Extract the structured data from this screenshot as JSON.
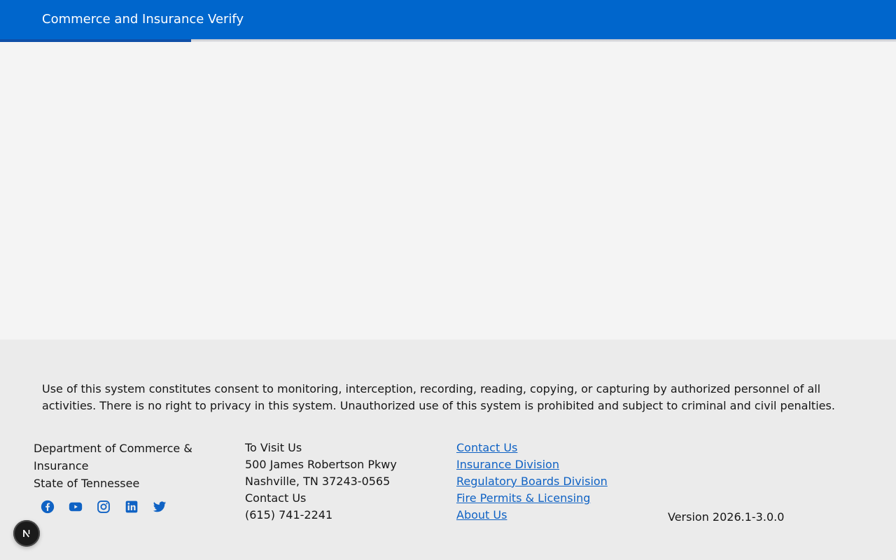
{
  "header": {
    "title": "Commerce and Insurance Verify",
    "background": "#0066cc",
    "progress_fraction": 0.213
  },
  "footer": {
    "disclaimer": "Use of this system constitutes consent to monitoring, interception, recording, reading, copying, or capturing by authorized personnel of all activities. There is no right to privacy in this system. Unauthorized use of this system is prohibited and subject to criminal and civil penalties.",
    "department": {
      "name": "Department of Commerce & Insurance",
      "state": "State of Tennessee"
    },
    "social_icons": [
      "facebook-icon",
      "youtube-icon",
      "instagram-icon",
      "linkedin-icon",
      "twitter-icon"
    ],
    "visit": {
      "heading": "To Visit Us",
      "street": "500 James Robertson Pkwy",
      "city": "Nashville, TN 37243-0565",
      "contact_heading": "Contact Us",
      "phone": "(615) 741-2241"
    },
    "links": [
      "Contact Us",
      "Insurance Division",
      "Regulatory Boards Division",
      "Fire Permits & Licensing",
      "About Us"
    ],
    "version": "Version 2026.1-3.0.0",
    "link_color": "#0f62c4"
  },
  "dev_badge": {
    "letter": "N",
    "icon": "nextjs-icon"
  }
}
